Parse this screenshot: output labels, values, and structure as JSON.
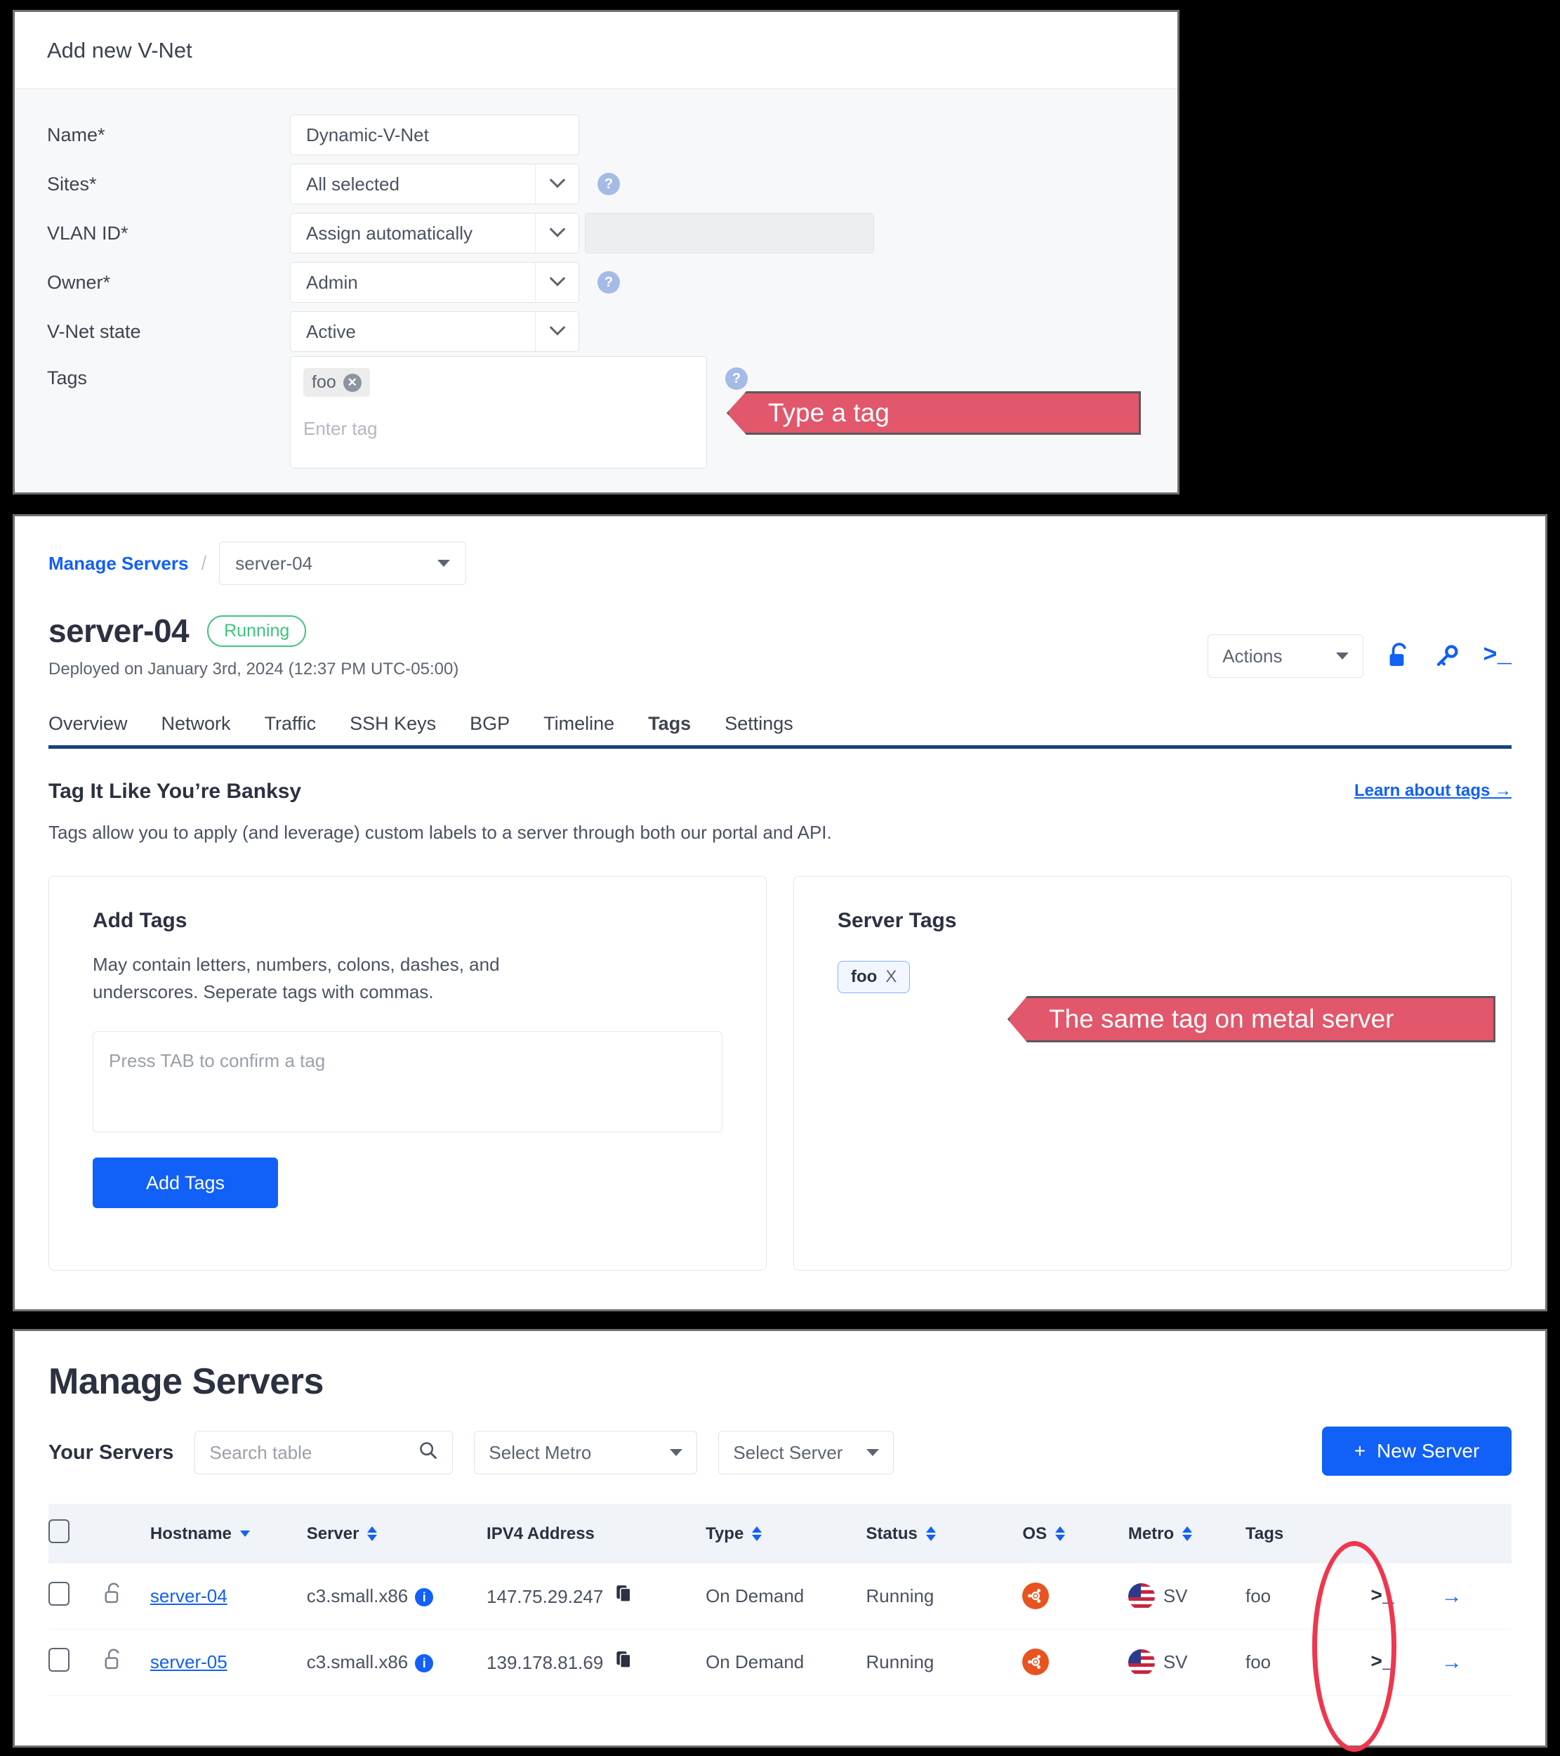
{
  "vnet_dialog": {
    "title": "Add new V-Net",
    "fields": {
      "name_label": "Name*",
      "name_value": "Dynamic-V-Net",
      "sites_label": "Sites*",
      "sites_value": "All selected",
      "vlan_label": "VLAN ID*",
      "vlan_value": "Assign automatically",
      "owner_label": "Owner*",
      "owner_value": "Admin",
      "state_label": "V-Net state",
      "state_value": "Active",
      "tags_label": "Tags",
      "tag_chip": "foo",
      "tag_placeholder": "Enter tag"
    },
    "help_icon": "?"
  },
  "callouts": {
    "type_a_tag": "Type a tag",
    "same_tag": "The same tag on metal server",
    "color": "#e2576b"
  },
  "server_page": {
    "breadcrumb_link": "Manage Servers",
    "breadcrumb_separator": "/",
    "breadcrumb_select": "server-04",
    "server_name": "server-04",
    "status_badge": "Running",
    "deployed": "Deployed on January 3rd, 2024 (12:37 PM UTC-05:00)",
    "actions_label": "Actions",
    "header_icons": [
      "unlock-icon",
      "key-icon",
      "terminal-icon"
    ],
    "tabs": [
      {
        "label": "Overview",
        "active": false
      },
      {
        "label": "Network",
        "active": false
      },
      {
        "label": "Traffic",
        "active": false
      },
      {
        "label": "SSH Keys",
        "active": false
      },
      {
        "label": "BGP",
        "active": false
      },
      {
        "label": "Timeline",
        "active": false
      },
      {
        "label": "Tags",
        "active": true
      },
      {
        "label": "Settings",
        "active": false
      }
    ],
    "tags_section": {
      "heading": "Tag It Like You’re Banksy",
      "description": "Tags allow you to apply (and leverage) custom labels to a server through both our portal and API.",
      "learn_link": "Learn about tags →",
      "add_card": {
        "heading": "Add Tags",
        "description": "May contain letters, numbers, colons, dashes, and underscores. Seperate tags with commas.",
        "input_placeholder": "Press TAB to confirm a tag",
        "button": "Add Tags"
      },
      "server_card": {
        "heading": "Server Tags",
        "tag": "foo",
        "tag_remove": "X"
      }
    }
  },
  "manage_servers": {
    "title": "Manage Servers",
    "your_servers_label": "Your Servers",
    "search_placeholder": "Search table",
    "select_metro": "Select Metro",
    "select_server": "Select Server",
    "new_server_button": "New Server",
    "new_server_plus": "+",
    "columns": [
      {
        "label": "",
        "sort": "none"
      },
      {
        "label": "Hostname",
        "sort": "desc"
      },
      {
        "label": "Server",
        "sort": "both"
      },
      {
        "label": "IPV4 Address",
        "sort": "none"
      },
      {
        "label": "Type",
        "sort": "both"
      },
      {
        "label": "Status",
        "sort": "both"
      },
      {
        "label": "OS",
        "sort": "both"
      },
      {
        "label": "Metro",
        "sort": "both"
      },
      {
        "label": "Tags",
        "sort": "none"
      }
    ],
    "rows": [
      {
        "hostname": "server-04",
        "server": "c3.small.x86",
        "ipv4": "147.75.29.247",
        "type": "On Demand",
        "status": "Running",
        "os": "ubuntu-icon",
        "metro": "SV",
        "tags": "foo"
      },
      {
        "hostname": "server-05",
        "server": "c3.small.x86",
        "ipv4": "139.178.81.69",
        "type": "On Demand",
        "status": "Running",
        "os": "ubuntu-icon",
        "metro": "SV",
        "tags": "foo"
      }
    ]
  }
}
